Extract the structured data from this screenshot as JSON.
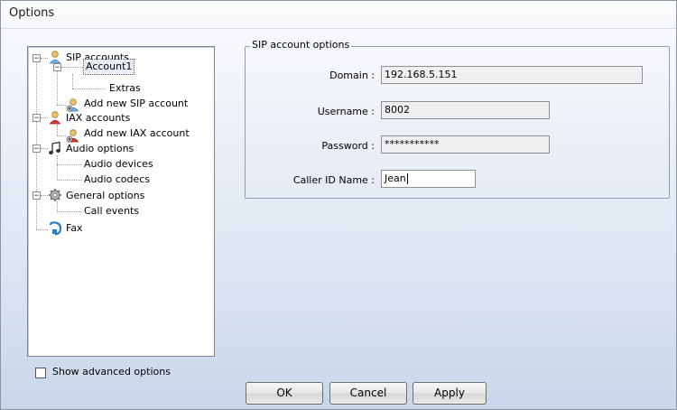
{
  "window": {
    "title": "Options"
  },
  "tree": {
    "items": [
      {
        "label": "SIP accounts",
        "icon": "sip-accounts-icon"
      },
      {
        "label": "Account1",
        "icon": ""
      },
      {
        "label": "Extras",
        "icon": ""
      },
      {
        "label": "Add new SIP account",
        "icon": "add-sip-account-icon"
      },
      {
        "label": "IAX accounts",
        "icon": "iax-accounts-icon"
      },
      {
        "label": "Add new IAX account",
        "icon": "add-iax-account-icon"
      },
      {
        "label": "Audio options",
        "icon": "audio-options-icon"
      },
      {
        "label": "Audio devices",
        "icon": ""
      },
      {
        "label": "Audio codecs",
        "icon": ""
      },
      {
        "label": "General options",
        "icon": "gear-icon"
      },
      {
        "label": "Call events",
        "icon": ""
      },
      {
        "label": "Fax",
        "icon": "fax-icon"
      }
    ],
    "selected": "Account1"
  },
  "sip_options": {
    "legend": "SIP account options",
    "domain_label": "Domain :",
    "domain_value": "192.168.5.151",
    "username_label": "Username :",
    "username_value": "8002",
    "password_label": "Password :",
    "password_value": "***********",
    "caller_id_label": "Caller ID Name :",
    "caller_id_value": "Jean"
  },
  "footer": {
    "show_advanced_label": "Show advanced options",
    "show_advanced_checked": false,
    "ok_label": "OK",
    "cancel_label": "Cancel",
    "apply_label": "Apply"
  }
}
